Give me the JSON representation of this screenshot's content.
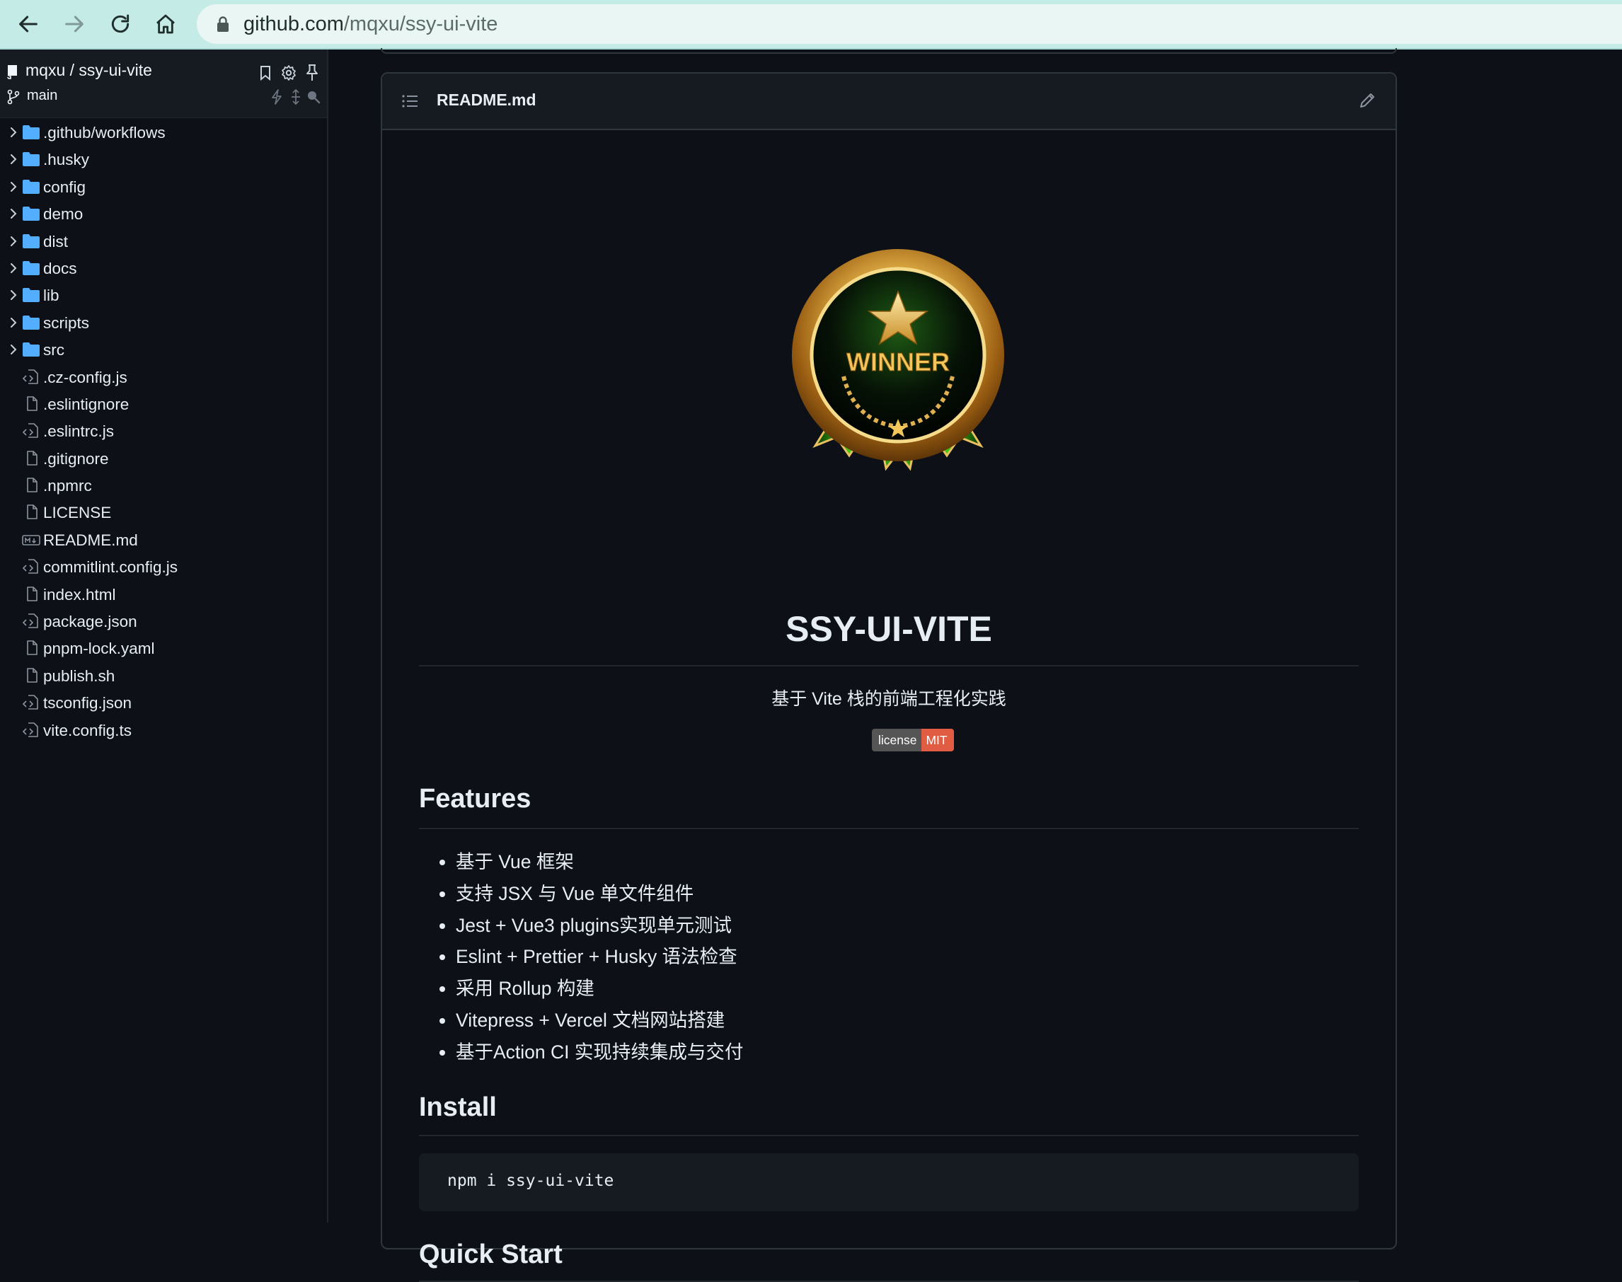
{
  "browser": {
    "url_host": "github.com",
    "url_path": "/mqxu/ssy-ui-vite",
    "icons": [
      "back-arrow-icon",
      "forward-arrow-icon",
      "reload-icon",
      "home-icon",
      "lock-icon"
    ]
  },
  "sidebar": {
    "repo": "mqxu / ssy-ui-vite",
    "branch": "main",
    "items": [
      {
        "name": ".github/workflows",
        "type": "folder"
      },
      {
        "name": ".husky",
        "type": "folder"
      },
      {
        "name": "config",
        "type": "folder"
      },
      {
        "name": "demo",
        "type": "folder"
      },
      {
        "name": "dist",
        "type": "folder"
      },
      {
        "name": "docs",
        "type": "folder"
      },
      {
        "name": "lib",
        "type": "folder"
      },
      {
        "name": "scripts",
        "type": "folder"
      },
      {
        "name": "src",
        "type": "folder"
      },
      {
        "name": ".cz-config.js",
        "type": "code"
      },
      {
        "name": ".eslintignore",
        "type": "file"
      },
      {
        "name": ".eslintrc.js",
        "type": "code"
      },
      {
        "name": ".gitignore",
        "type": "file"
      },
      {
        "name": ".npmrc",
        "type": "file"
      },
      {
        "name": "LICENSE",
        "type": "file"
      },
      {
        "name": "README.md",
        "type": "markdown"
      },
      {
        "name": "commitlint.config.js",
        "type": "code"
      },
      {
        "name": "index.html",
        "type": "file"
      },
      {
        "name": "package.json",
        "type": "code"
      },
      {
        "name": "pnpm-lock.yaml",
        "type": "file"
      },
      {
        "name": "publish.sh",
        "type": "file"
      },
      {
        "name": "tsconfig.json",
        "type": "code"
      },
      {
        "name": "vite.config.ts",
        "type": "code"
      }
    ]
  },
  "readme": {
    "filename": "README.md",
    "medal_text": "WINNER",
    "title": "SSY-UI-VITE",
    "subtitle": "基于 Vite 栈的前端工程化实践",
    "badge": {
      "label": "license",
      "value": "MIT",
      "color": "#e05d44"
    },
    "features_heading": "Features",
    "features": [
      "基于 Vue 框架",
      "支持 JSX 与 Vue 单文件组件",
      "Jest + Vue3 plugins实现单元测试",
      "Eslint + Prettier + Husky 语法检查",
      "采用 Rollup 构建",
      "Vitepress + Vercel 文档网站搭建",
      "基于Action CI 实现持续集成与交付"
    ],
    "install_heading": "Install",
    "install_command": "npm i ssy-ui-vite",
    "quickstart_heading": "Quick Start"
  },
  "colors": {
    "background": "#0d1117",
    "panel": "#161b22",
    "border": "#30363d",
    "folder": "#54aeff",
    "browser_bar": "#c5ebe7"
  }
}
